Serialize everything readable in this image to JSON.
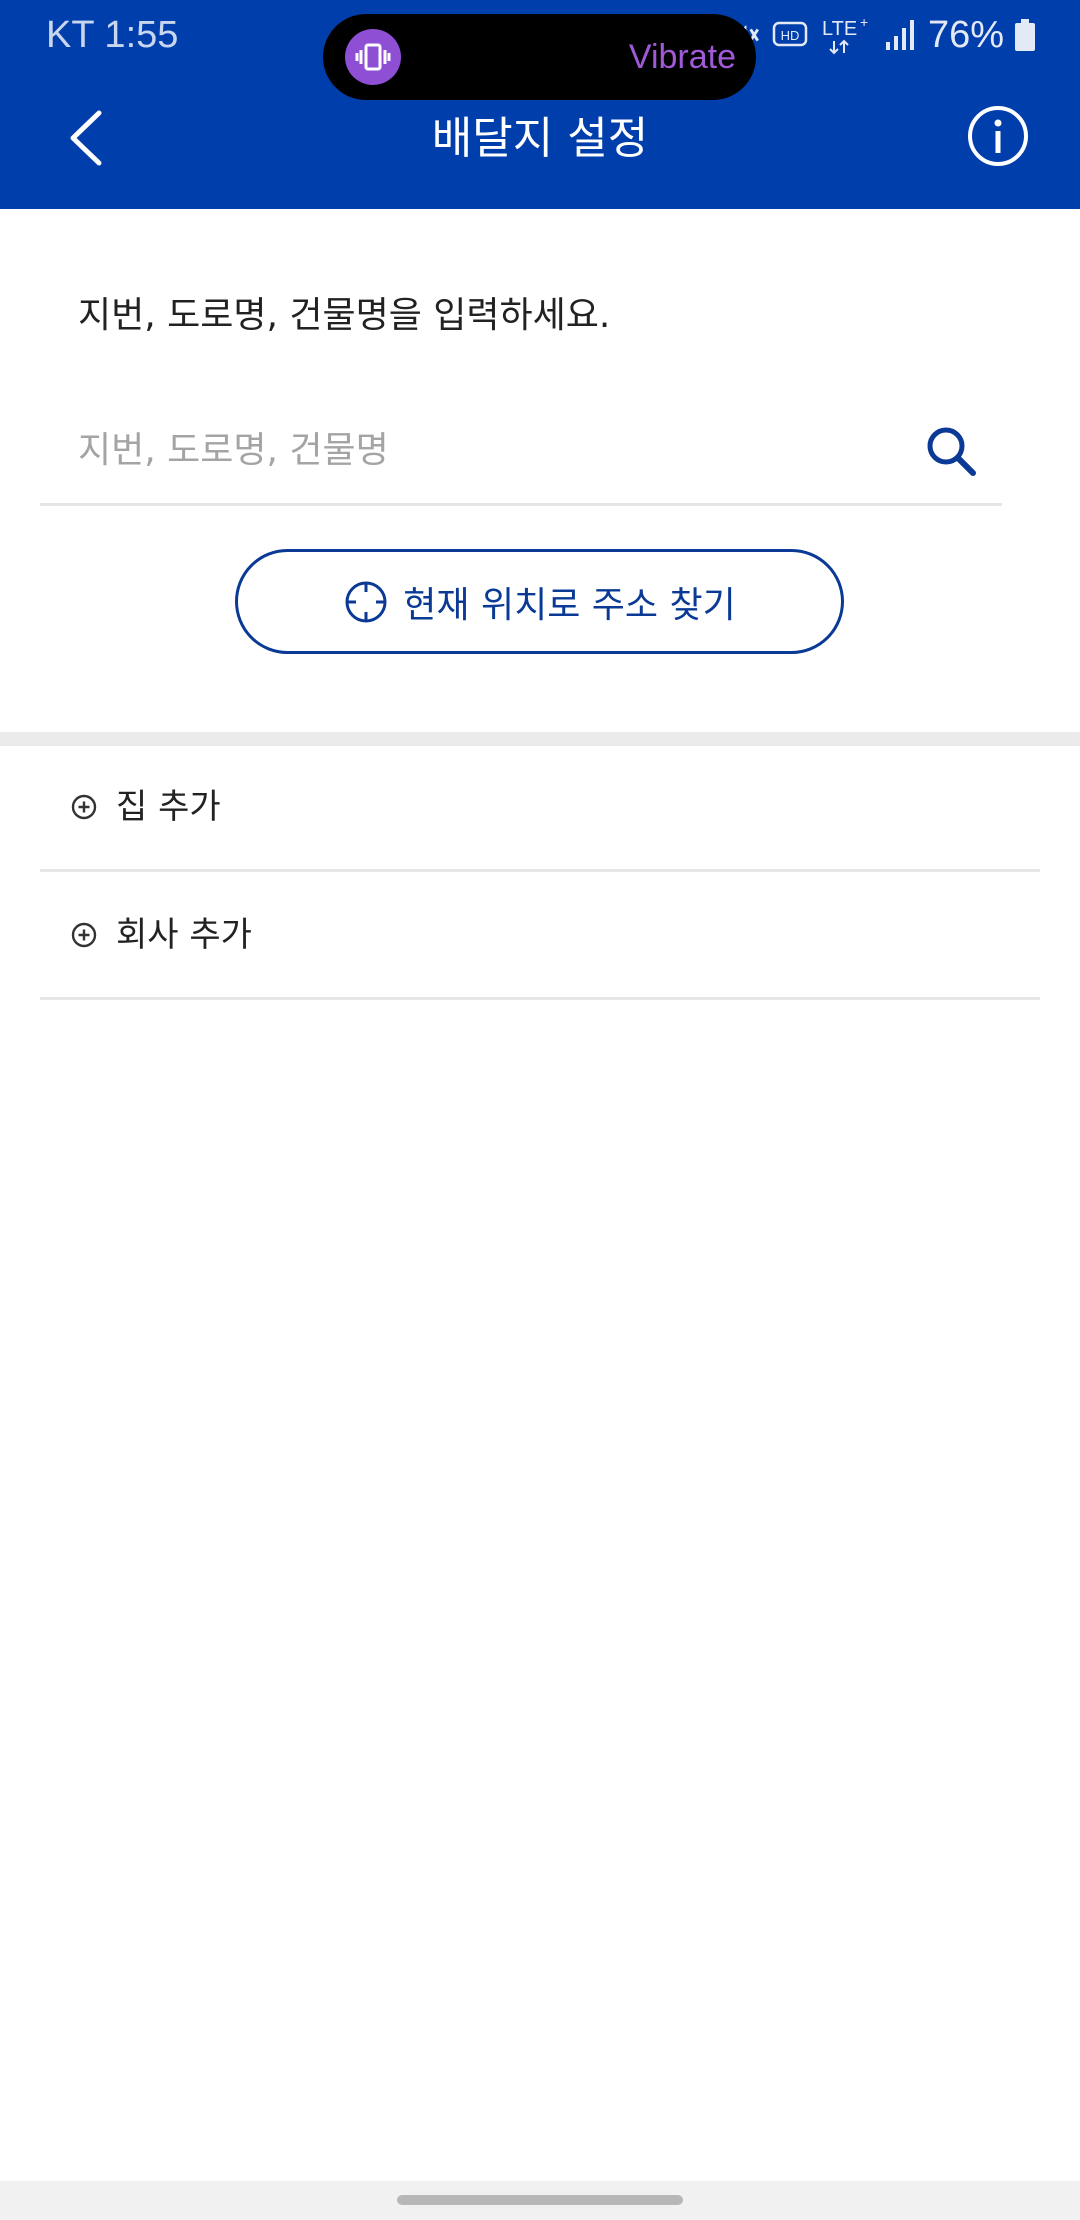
{
  "status_bar": {
    "time": "KT 1:55",
    "notification": "Vibrate",
    "battery": "76%",
    "icons": [
      "vibrate-icon",
      "mute-icon",
      "hd-icon",
      "lte-icon",
      "signal-icon",
      "battery-icon"
    ]
  },
  "app_bar": {
    "title": "배달지 설정",
    "back_icon": "chevron-left-icon",
    "info_icon": "info-icon"
  },
  "content": {
    "instruction": "지번, 도로명, 건물명을 입력하세요.",
    "search": {
      "placeholder": "지번, 도로명, 건물명",
      "value": "",
      "icon": "search-icon"
    },
    "locate_button": {
      "label": "현재 위치로 주소 찾기",
      "icon": "crosshair-icon"
    },
    "saved_addresses": [
      {
        "label": "집 추가",
        "icon": "plus-circle-icon"
      },
      {
        "label": "회사 추가",
        "icon": "plus-circle-icon"
      }
    ]
  },
  "colors": {
    "primary": "#003fab",
    "accent_text": "#0a3a95",
    "divider": "#e6e6e6",
    "notification_accent": "#8e4fd4"
  }
}
